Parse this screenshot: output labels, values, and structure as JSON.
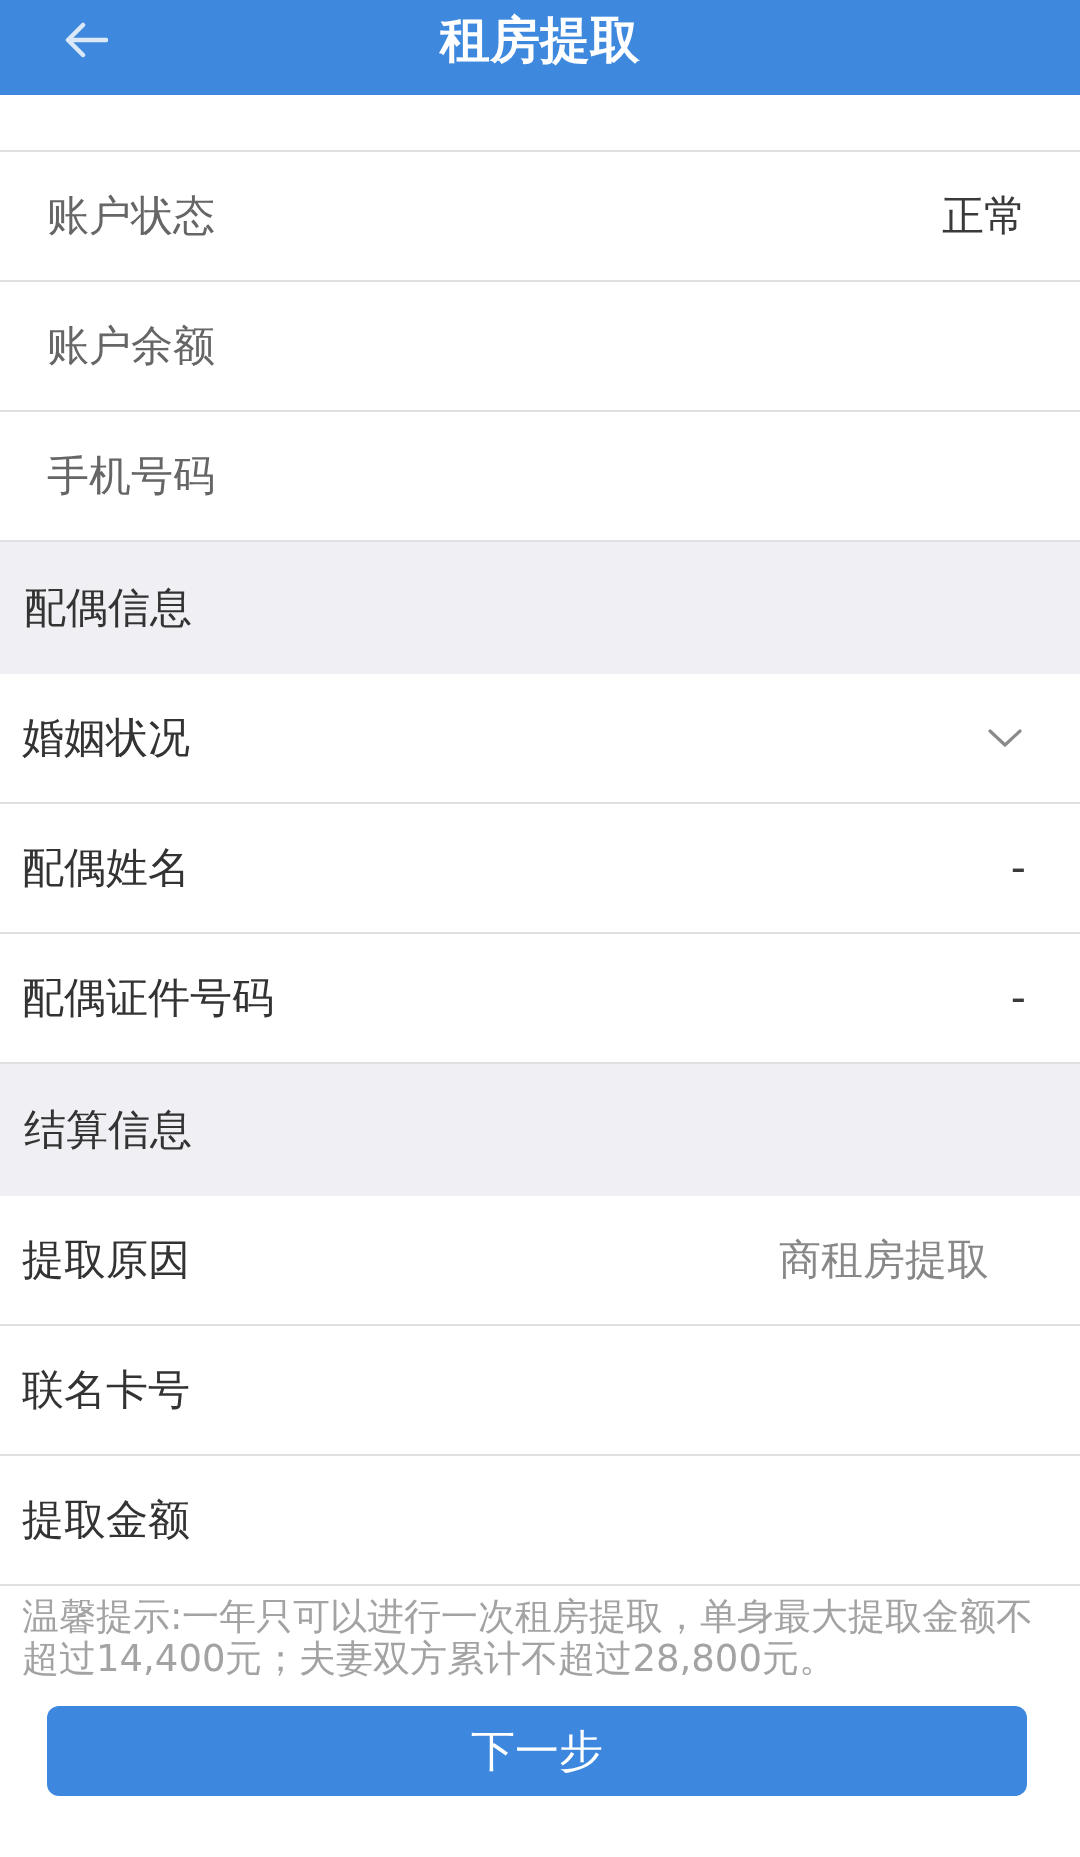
{
  "header": {
    "title": "租房提取"
  },
  "groups": [
    {
      "kind": "inset",
      "rows": [
        {
          "kind": "static",
          "label": "账户状态",
          "value": "正常"
        },
        {
          "kind": "static",
          "label": "账户余额"
        },
        {
          "kind": "static",
          "label": "手机号码"
        }
      ]
    },
    {
      "kind": "section",
      "title": "配偶信息",
      "rows": [
        {
          "kind": "select",
          "label": "婚姻状况"
        },
        {
          "kind": "static",
          "label": "配偶姓名",
          "value": "-"
        },
        {
          "kind": "static",
          "label": "配偶证件号码",
          "value": "-"
        }
      ]
    },
    {
      "kind": "section",
      "title": "结算信息",
      "rows": [
        {
          "kind": "choice",
          "label": "提取原因",
          "value": "商租房提取"
        },
        {
          "kind": "static",
          "label": "联名卡号"
        },
        {
          "kind": "static",
          "label": "提取金额"
        }
      ]
    }
  ],
  "tip": "温馨提示:一年只可以进行一次租房提取，单身最大提取金额不超过14,400元；夫妻双方累计不超过28,800元。",
  "next_button": "下一步"
}
